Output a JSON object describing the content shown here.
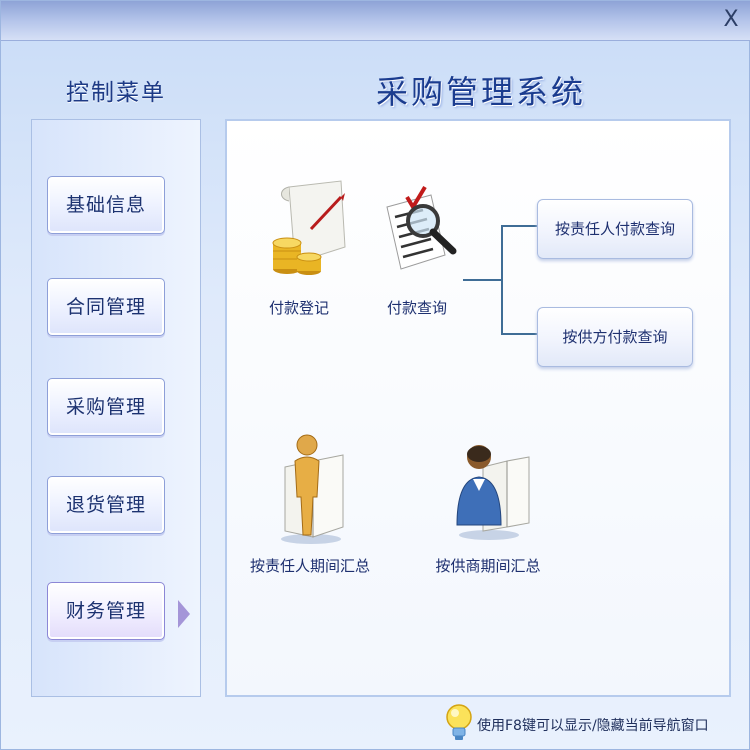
{
  "window": {
    "close_label": "X"
  },
  "sidebar": {
    "title": "控制菜单",
    "items": [
      {
        "label": "基础信息"
      },
      {
        "label": "合同管理"
      },
      {
        "label": "采购管理"
      },
      {
        "label": "退货管理"
      },
      {
        "label": "财务管理",
        "active": true
      }
    ]
  },
  "main": {
    "title": "采购管理系统",
    "features": [
      {
        "label": "付款登记",
        "icon": "payment-register-icon"
      },
      {
        "label": "付款查询",
        "icon": "payment-query-icon"
      },
      {
        "label": "按责任人期间汇总",
        "icon": "person-summary-icon"
      },
      {
        "label": "按供商期间汇总",
        "icon": "supplier-summary-icon"
      }
    ],
    "query_buttons": [
      {
        "label": "按责任人付款查询"
      },
      {
        "label": "按供方付款查询"
      }
    ]
  },
  "status": {
    "hint": "使用F8键可以显示/隐藏当前导航窗口",
    "icon": "lightbulb-icon"
  },
  "colors": {
    "title_blue": "#1b3c8f",
    "connector": "#3f6d96",
    "panel_border": "#b6cbed"
  }
}
